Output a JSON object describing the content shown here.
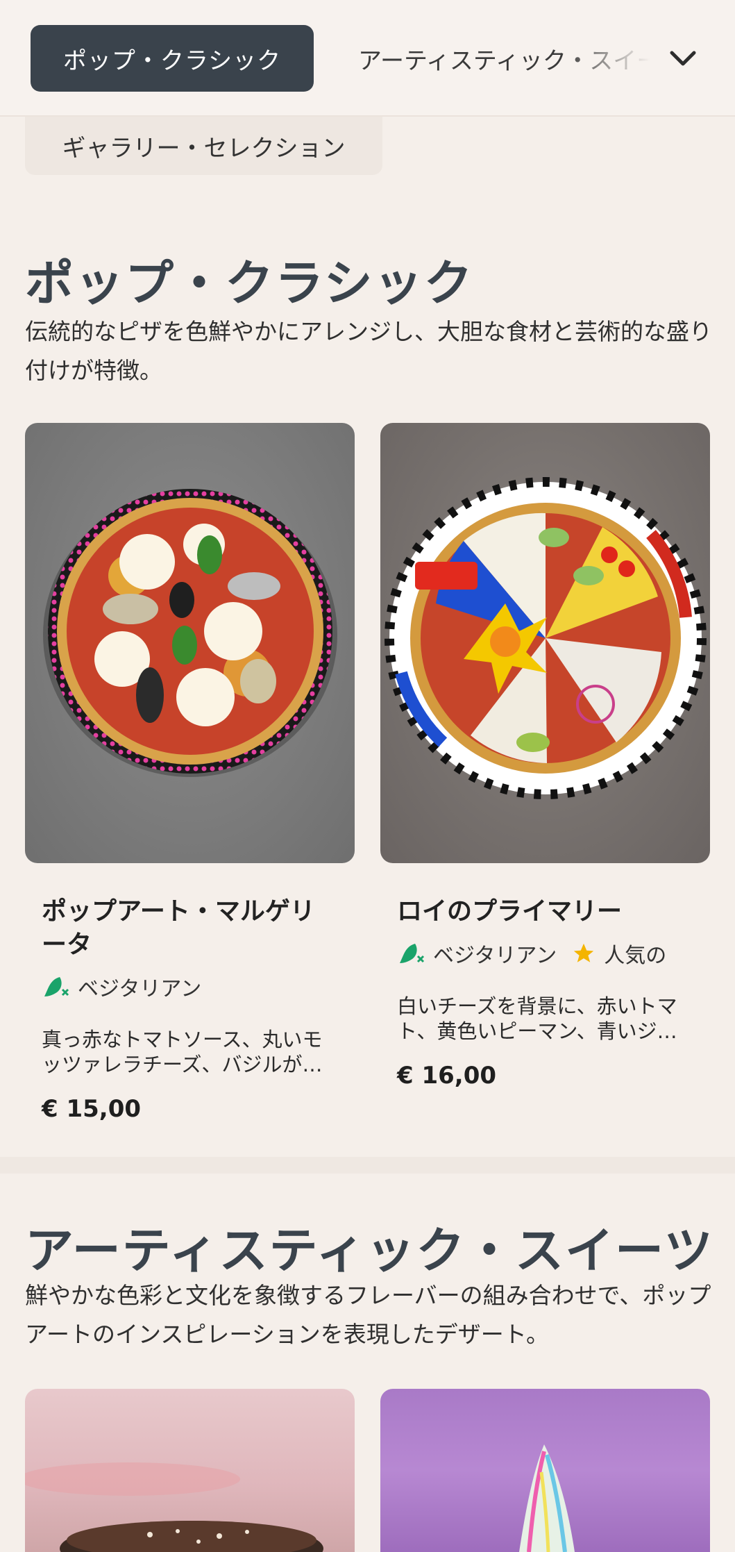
{
  "nav": {
    "active_tab": "ポップ・クラシック",
    "next_tab": "アーティスティック・スイーツ",
    "second_row_tab": "ギャラリー・セレクション"
  },
  "sections": [
    {
      "title": "ポップ・クラシック",
      "description": "伝統的なピザを色鮮やかにアレンジし、大胆な食材と芸術的な盛り付けが特徴。",
      "items": [
        {
          "name": "ポップアート・マルゲリータ",
          "tags": [
            "ベジタリアン"
          ],
          "description": "真っ赤なトマトソース、丸いモッツァレラチーズ、バジルが…",
          "price": "€ 15,00"
        },
        {
          "name": "ロイのプライマリー",
          "tags": [
            "ベジタリアン",
            "人気の"
          ],
          "description": "白いチーズを背景に、赤いトマト、黄色いピーマン、青いジ…",
          "price": "€ 16,00"
        }
      ]
    },
    {
      "title": "アーティスティック・スイーツ",
      "description": "鮮やかな色彩と文化を象徴するフレーバーの組み合わせで、ポップアートのインスピレーションを表現したデザート。"
    }
  ],
  "colors": {
    "background": "#f5efea",
    "active_pill": "#3a434c",
    "vegetarian_icon": "#1aa36a",
    "popular_star": "#f4b400"
  }
}
